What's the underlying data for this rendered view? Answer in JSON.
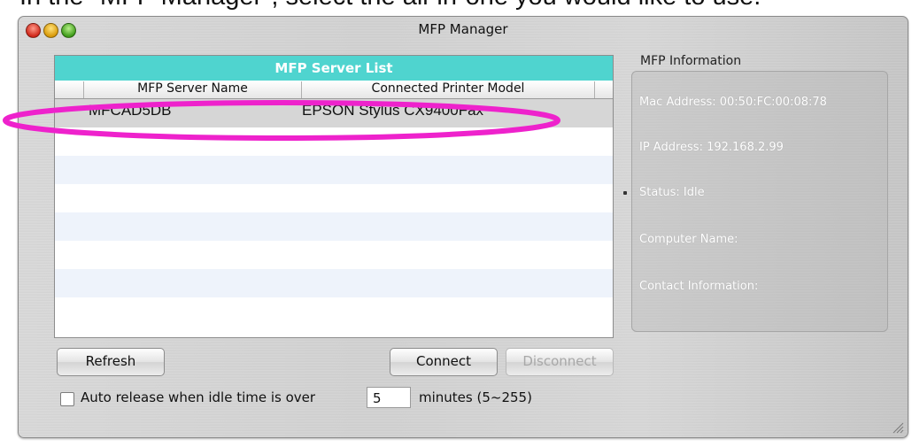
{
  "caption": "In the \"MFP Manager\", select the all-in-one you would like to use.",
  "window": {
    "title": "MFP Manager"
  },
  "server_list": {
    "header": "MFP Server List",
    "columns": [
      "MFP Server Name",
      "Connected Printer Model"
    ],
    "rows": [
      {
        "name": "MFCAD5DB",
        "model": "EPSON Stylus CX9400Fax",
        "selected": true
      }
    ]
  },
  "info": {
    "label": "MFP Information",
    "mac": "Mac Address: 00:50:FC:00:08:78",
    "ip": "IP Address: 192.168.2.99",
    "status": "Status: Idle",
    "computer": "Computer Name:",
    "contact": "Contact Information:"
  },
  "buttons": {
    "refresh": "Refresh",
    "connect": "Connect",
    "disconnect": "Disconnect"
  },
  "auto_release": {
    "label": "Auto release when idle time is over",
    "value": "5",
    "unit": "minutes (5~255)",
    "checked": false
  },
  "colors": {
    "list_header": "#4fd4cf",
    "annotation": "#ee22cc"
  },
  "icons": {
    "close": "close-icon",
    "minimize": "minimize-icon",
    "zoom": "zoom-icon",
    "resize": "resize-grip-icon"
  }
}
